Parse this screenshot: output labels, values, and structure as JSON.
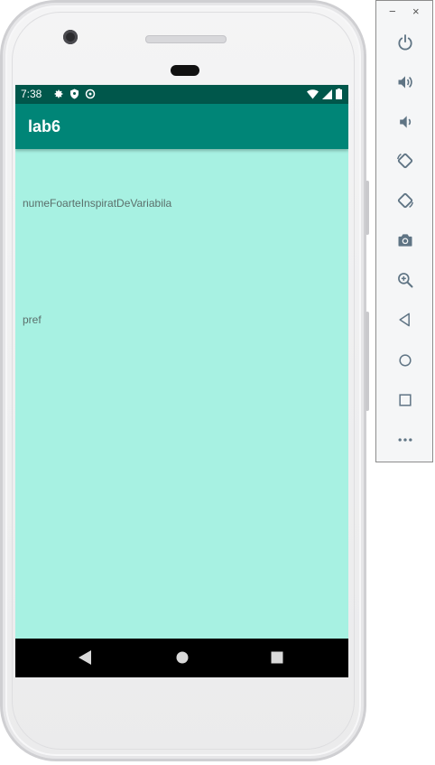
{
  "status_bar": {
    "time": "7:38"
  },
  "app_bar": {
    "title": "lab6"
  },
  "content": {
    "text1": "numeFoarteInspiratDeVariabila",
    "text2": "pref"
  },
  "colors": {
    "status_bar": "#00574b",
    "app_bar": "#008577",
    "screen_background": "#a7f1e2",
    "nav_bar": "#000000",
    "toolbar_icon": "#5f7484"
  },
  "emulator_toolbar": {
    "minimize_label": "−",
    "close_label": "×",
    "buttons": [
      "power-icon",
      "volume-up-icon",
      "volume-down-icon",
      "rotate-left-icon",
      "rotate-right-icon",
      "camera-icon",
      "zoom-icon",
      "back-icon",
      "home-icon",
      "overview-icon",
      "more-icon"
    ]
  }
}
